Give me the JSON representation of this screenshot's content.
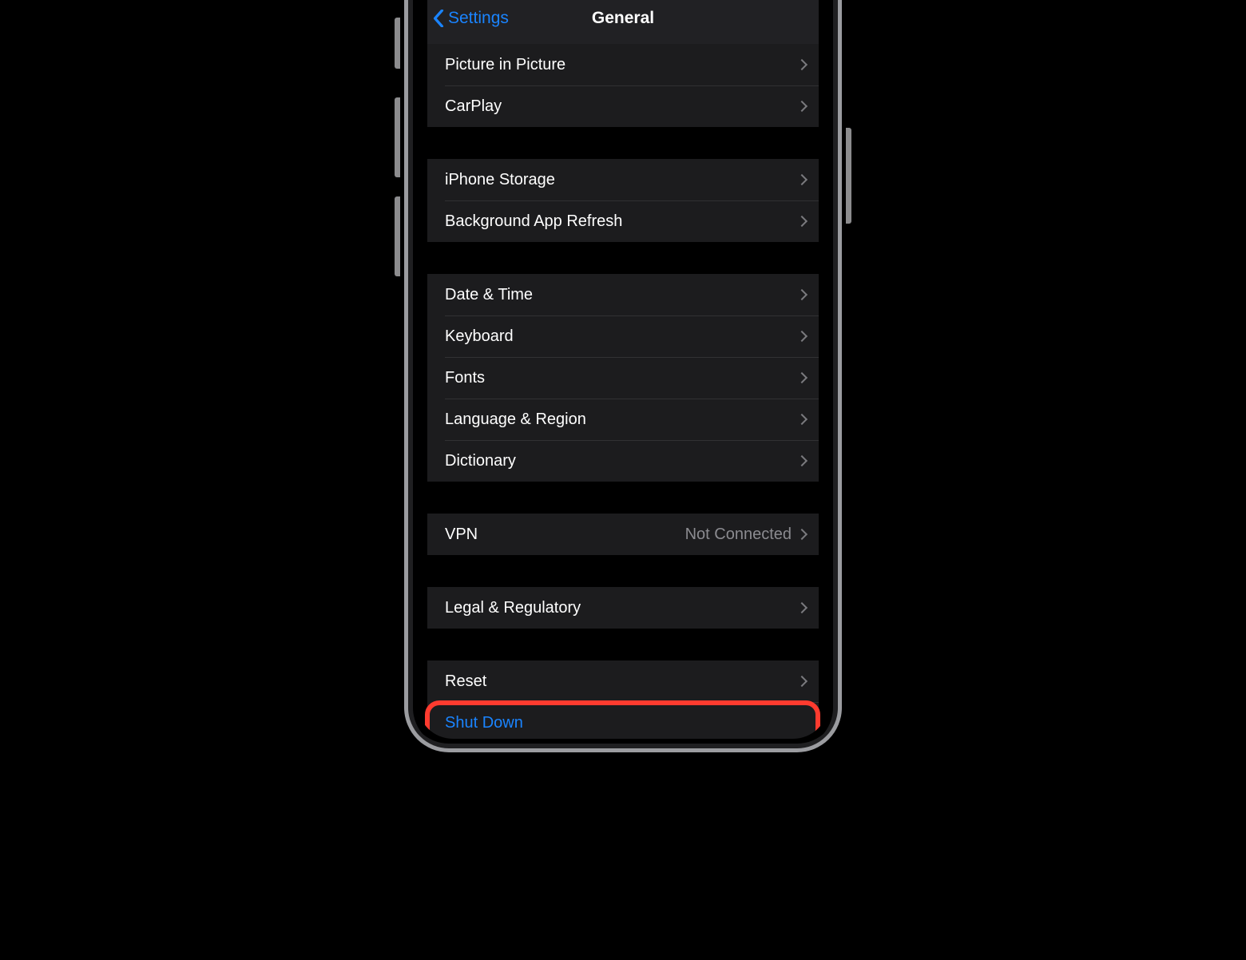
{
  "nav": {
    "back_label": "Settings",
    "title": "General"
  },
  "groups": [
    {
      "rows": [
        {
          "label": "Picture in Picture",
          "detail": "",
          "chevron": true,
          "key": "picture-in-picture"
        },
        {
          "label": "CarPlay",
          "detail": "",
          "chevron": true,
          "key": "carplay"
        }
      ]
    },
    {
      "rows": [
        {
          "label": "iPhone Storage",
          "detail": "",
          "chevron": true,
          "key": "iphone-storage"
        },
        {
          "label": "Background App Refresh",
          "detail": "",
          "chevron": true,
          "key": "background-app-refresh"
        }
      ]
    },
    {
      "rows": [
        {
          "label": "Date & Time",
          "detail": "",
          "chevron": true,
          "key": "date-time"
        },
        {
          "label": "Keyboard",
          "detail": "",
          "chevron": true,
          "key": "keyboard"
        },
        {
          "label": "Fonts",
          "detail": "",
          "chevron": true,
          "key": "fonts"
        },
        {
          "label": "Language & Region",
          "detail": "",
          "chevron": true,
          "key": "language-region"
        },
        {
          "label": "Dictionary",
          "detail": "",
          "chevron": true,
          "key": "dictionary"
        }
      ]
    },
    {
      "rows": [
        {
          "label": "VPN",
          "detail": "Not Connected",
          "chevron": true,
          "key": "vpn"
        }
      ]
    },
    {
      "rows": [
        {
          "label": "Legal & Regulatory",
          "detail": "",
          "chevron": true,
          "key": "legal-regulatory"
        }
      ]
    },
    {
      "rows": [
        {
          "label": "Reset",
          "detail": "",
          "chevron": true,
          "key": "reset"
        },
        {
          "label": "Shut Down",
          "detail": "",
          "chevron": false,
          "key": "shut-down",
          "accent": true
        }
      ]
    }
  ],
  "highlight_key": "shut-down"
}
